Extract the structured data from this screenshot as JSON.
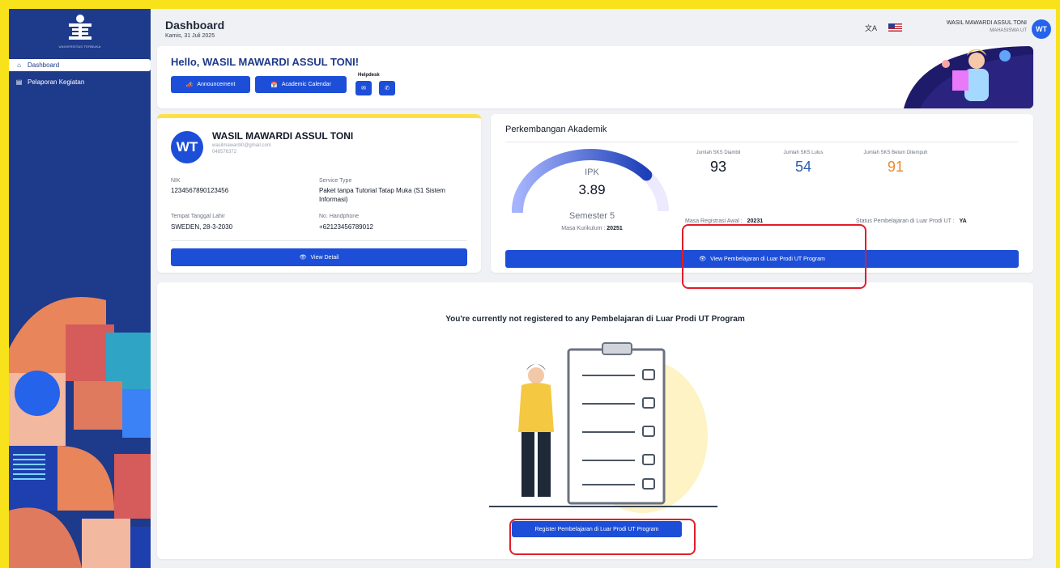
{
  "sidebar": {
    "logo_text": "UNIVERSITAS TERBUKA",
    "items": [
      {
        "label": "Dashboard",
        "icon": "home-icon",
        "active": true
      },
      {
        "label": "Pelaporan Kegiatan",
        "icon": "report-icon",
        "active": false
      }
    ]
  },
  "header": {
    "title": "Dashboard",
    "date": "Kamis, 31 Juli 2025",
    "lang_icon": "translate-icon",
    "user_name": "WASIL MAWARDI ASSUL TONI",
    "user_role": "MAHASISWA UT",
    "avatar_initials": "WT"
  },
  "hello": {
    "greeting": "Hello, WASIL MAWARDI ASSUL TONI!",
    "announcement_label": "Announcement",
    "calendar_label": "Academic Calendar",
    "helpdesk_label": "Helpdesk"
  },
  "profile": {
    "initials": "WT",
    "name": "WASIL MAWARDI ASSUL TONI",
    "email": "wasilmawardi0@gmail.com",
    "student_no": "048576372",
    "nik_label": "NIK",
    "nik": "1234567890123456",
    "service_label": "Service Type",
    "service": "Paket tanpa Tutorial Tatap Muka (S1 Sistem Informasi)",
    "ttl_label": "Tempat Tanggal Lahir",
    "ttl": "SWEDEN, 28-3-2030",
    "hp_label": "No. Handphone",
    "hp": "+62123456789012",
    "detail_button": "View Detail"
  },
  "akademik": {
    "title": "Perkembangan Akademik",
    "ipk_label": "IPK",
    "ipk": "3.89",
    "ipk_progress": 0.78,
    "semester": "Semester 5",
    "kurikulum_label": "Masa Kurikulum :",
    "kurikulum": "20251",
    "sks": [
      {
        "label": "Jumlah SKS Diambil",
        "value": "93",
        "color": "#111827"
      },
      {
        "label": "Jumlah SKS Lulus",
        "value": "54",
        "color": "#2b5fb0"
      },
      {
        "label": "Jumlah SKS Belum Ditempuh",
        "value": "91",
        "color": "#e58a2e"
      }
    ],
    "registrasi_label": "Masa Registrasi Awal :",
    "registrasi": "20231",
    "status_label": "Status Pembelajaran di Luar Prodi UT :",
    "status": "YA",
    "view_button": "View Pembelajaran di Luar Prodi UT Program"
  },
  "empty_state": {
    "message": "You're currently not registered to any Pembelajaran di Luar Prodi UT Program",
    "register_button": "Register Pembelajaran di Luar Prodi UT Program"
  },
  "colors": {
    "primary": "#1d4ed8",
    "sidebar": "#1e3a8a",
    "highlight": "#e11d2a",
    "frame": "#f7e21c"
  }
}
